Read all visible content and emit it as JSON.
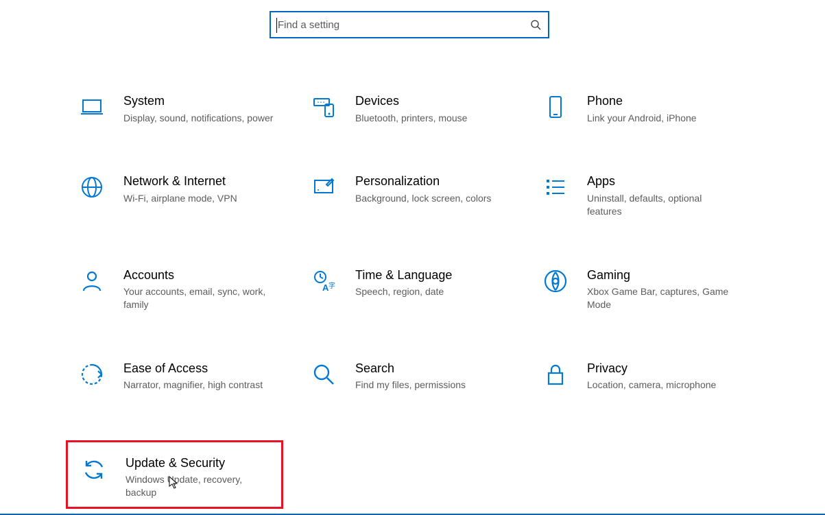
{
  "search": {
    "placeholder": "Find a setting",
    "value": ""
  },
  "tiles": {
    "system": {
      "title": "System",
      "desc": "Display, sound, notifications, power"
    },
    "devices": {
      "title": "Devices",
      "desc": "Bluetooth, printers, mouse"
    },
    "phone": {
      "title": "Phone",
      "desc": "Link your Android, iPhone"
    },
    "network": {
      "title": "Network & Internet",
      "desc": "Wi-Fi, airplane mode, VPN"
    },
    "personalization": {
      "title": "Personalization",
      "desc": "Background, lock screen, colors"
    },
    "apps": {
      "title": "Apps",
      "desc": "Uninstall, defaults, optional features"
    },
    "accounts": {
      "title": "Accounts",
      "desc": "Your accounts, email, sync, work, family"
    },
    "time": {
      "title": "Time & Language",
      "desc": "Speech, region, date"
    },
    "gaming": {
      "title": "Gaming",
      "desc": "Xbox Game Bar, captures, Game Mode"
    },
    "ease": {
      "title": "Ease of Access",
      "desc": "Narrator, magnifier, high contrast"
    },
    "search_tile": {
      "title": "Search",
      "desc": "Find my files, permissions"
    },
    "privacy": {
      "title": "Privacy",
      "desc": "Location, camera, microphone"
    },
    "update": {
      "title": "Update & Security",
      "desc": "Windows Update, recovery, backup"
    }
  }
}
